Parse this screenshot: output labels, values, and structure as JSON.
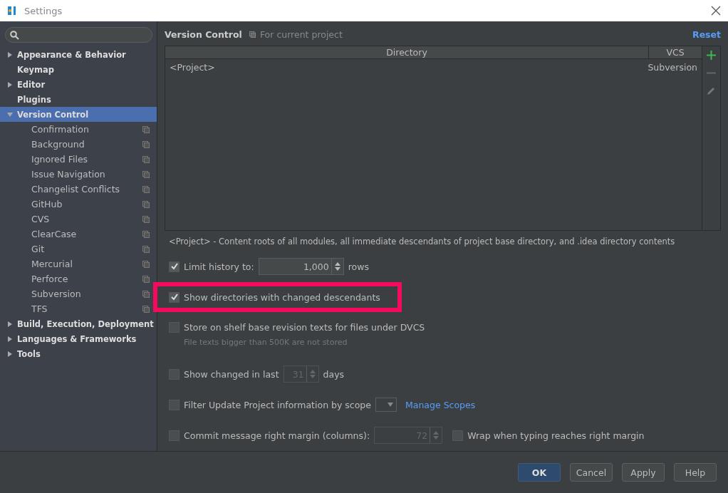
{
  "window": {
    "title": "Settings"
  },
  "sidebar": {
    "items": [
      {
        "label": "Appearance & Behavior",
        "expanded": false,
        "has_children": true,
        "selected": false
      },
      {
        "label": "Keymap",
        "has_children": false,
        "selected": false
      },
      {
        "label": "Editor",
        "expanded": false,
        "has_children": true,
        "selected": false
      },
      {
        "label": "Plugins",
        "has_children": false,
        "selected": false
      },
      {
        "label": "Version Control",
        "expanded": true,
        "has_children": true,
        "selected": true,
        "children": [
          {
            "label": "Confirmation",
            "selected": false
          },
          {
            "label": "Background",
            "selected": false
          },
          {
            "label": "Ignored Files",
            "selected": false
          },
          {
            "label": "Issue Navigation",
            "selected": false
          },
          {
            "label": "Changelist Conflicts",
            "selected": false
          },
          {
            "label": "GitHub",
            "selected": false
          },
          {
            "label": "CVS",
            "selected": false
          },
          {
            "label": "ClearCase",
            "selected": false
          },
          {
            "label": "Git",
            "selected": false
          },
          {
            "label": "Mercurial",
            "selected": false
          },
          {
            "label": "Perforce",
            "selected": false
          },
          {
            "label": "Subversion",
            "selected": false
          },
          {
            "label": "TFS",
            "selected": false
          }
        ]
      },
      {
        "label": "Build, Execution, Deployment",
        "expanded": false,
        "has_children": true,
        "selected": false
      },
      {
        "label": "Languages & Frameworks",
        "expanded": false,
        "has_children": true,
        "selected": false
      },
      {
        "label": "Tools",
        "expanded": false,
        "has_children": true,
        "selected": false
      }
    ]
  },
  "header": {
    "title": "Version Control",
    "scope": "For current project",
    "reset": "Reset"
  },
  "table": {
    "columns": [
      "Directory",
      "VCS"
    ],
    "rows": [
      {
        "directory": "<Project>",
        "vcs": "Subversion"
      }
    ]
  },
  "note": "<Project> - Content roots of all modules, all immediate descendants of project base directory, and .idea directory contents",
  "options": [
    {
      "kind": "spinner",
      "label": "Limit history to:",
      "checked": true,
      "enabled": true,
      "value": "1,000",
      "suffix": "rows"
    },
    {
      "kind": "plain",
      "label": "Show directories with changed descendants",
      "checked": true,
      "highlighted": true
    },
    {
      "kind": "hint",
      "label": "Store on shelf base revision texts for files under DVCS",
      "checked": false,
      "hint": "File texts bigger than 500K are not stored"
    },
    {
      "kind": "spinner",
      "label": "Show changed in last",
      "checked": false,
      "enabled": false,
      "value": "31",
      "suffix": "days"
    },
    {
      "kind": "scope",
      "label": "Filter Update Project information by scope",
      "checked": false,
      "link": "Manage Scopes"
    },
    {
      "kind": "margin",
      "label": "Commit message right margin (columns):",
      "checked": false,
      "enabled": false,
      "value": "72",
      "wrap": {
        "label": "Wrap when typing reaches right margin",
        "checked": false
      }
    }
  ],
  "buttons": [
    {
      "label": "OK",
      "default": true
    },
    {
      "label": "Cancel",
      "default": false
    },
    {
      "label": "Apply",
      "default": false
    },
    {
      "label": "Help",
      "default": false
    }
  ]
}
